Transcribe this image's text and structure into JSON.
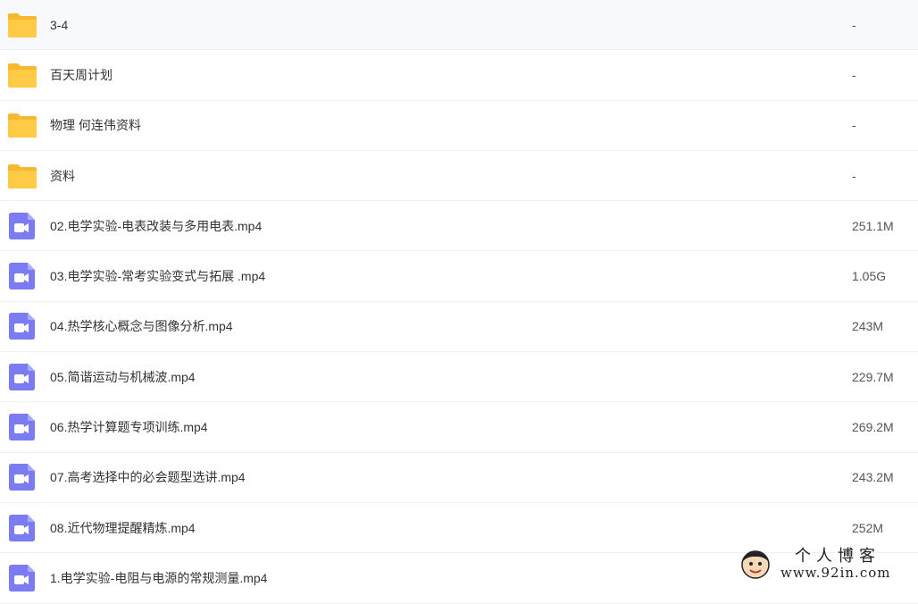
{
  "files": [
    {
      "type": "folder",
      "name": "3-4",
      "size": "-"
    },
    {
      "type": "folder",
      "name": "百天周计划",
      "size": "-"
    },
    {
      "type": "folder",
      "name": "物理 何连伟资料",
      "size": "-"
    },
    {
      "type": "folder",
      "name": "资料",
      "size": "-"
    },
    {
      "type": "video",
      "name": "02.电学实验-电表改装与多用电表.mp4",
      "size": "251.1M"
    },
    {
      "type": "video",
      "name": "03.电学实验-常考实验变式与拓展 .mp4",
      "size": "1.05G"
    },
    {
      "type": "video",
      "name": "04.热学核心概念与图像分析.mp4",
      "size": "243M"
    },
    {
      "type": "video",
      "name": "05.简谐运动与机械波.mp4",
      "size": "229.7M"
    },
    {
      "type": "video",
      "name": "06.热学计算题专项训练.mp4",
      "size": "269.2M"
    },
    {
      "type": "video",
      "name": "07.高考选择中的必会题型选讲.mp4",
      "size": "243.2M"
    },
    {
      "type": "video",
      "name": "08.近代物理提醒精炼.mp4",
      "size": "252M"
    },
    {
      "type": "video",
      "name": "1.电学实验-电阻与电源的常规测量.mp4",
      "size": ""
    }
  ],
  "watermark": {
    "title": "个人博客",
    "url": "www.92in.com"
  },
  "colors": {
    "folder": "#FFCB47",
    "folder_tab": "#F5B82E",
    "video": "#7B7BF2"
  }
}
